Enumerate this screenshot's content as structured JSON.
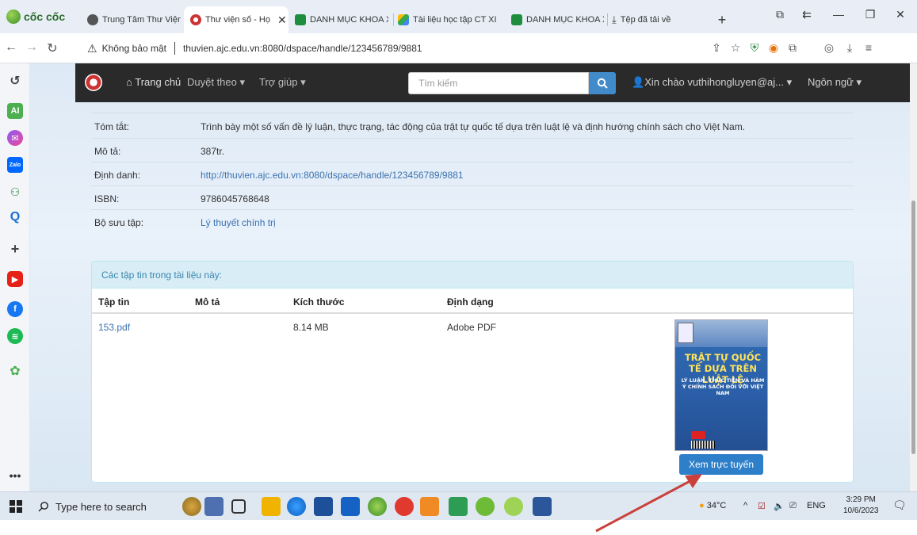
{
  "browser": {
    "brand": "cốc cốc",
    "tabs": [
      {
        "label": "Trung Tâm Thư Viện -",
        "active": false
      },
      {
        "label": "Thư viện số - Họ",
        "active": true
      },
      {
        "label": "DANH MỤC KHOA XI",
        "active": false
      },
      {
        "label": "Tài liệu học tập CT XI",
        "active": false
      },
      {
        "label": "DANH MỤC KHOA XI",
        "active": false
      },
      {
        "label": "Tệp đã tải về",
        "active": false
      }
    ],
    "security_label": "Không bảo mật",
    "url": "thuvien.ajc.edu.vn:8080/dspace/handle/123456789/9881"
  },
  "site_nav": {
    "home": "Trang chủ",
    "browse": "Duyệt theo",
    "help": "Trợ giúp",
    "search_placeholder": "Tìm kiếm",
    "greeting": "Xin chào vuthihongluyen@aj...",
    "language": "Ngôn ngữ"
  },
  "metadata": [
    {
      "label": "Tóm tắt:",
      "value": "Trình bày một số vấn đề lý luận, thực trạng, tác động của trật tự quốc tế dựa trên luật lệ và định hướng chính sách cho Việt Nam.",
      "link": false
    },
    {
      "label": "Mô tả:",
      "value": "387tr.",
      "link": false
    },
    {
      "label": "Định danh:",
      "value": "http://thuvien.ajc.edu.vn:8080/dspace/handle/123456789/9881",
      "link": true
    },
    {
      "label": "ISBN:",
      "value": "9786045768648",
      "link": false
    },
    {
      "label": "Bộ sưu tập:",
      "value": "Lý thuyết chính trị",
      "link": true
    }
  ],
  "files": {
    "panel_title": "Các tập tin trong tài liệu này:",
    "columns": [
      "Tập tin",
      "Mô tả",
      "Kích thước",
      "Định dạng"
    ],
    "rows": [
      {
        "file": "153.pdf",
        "description": "",
        "size": "8.14 MB",
        "format": "Adobe PDF"
      }
    ],
    "cover_title": "TRẬT TỰ QUỐC TẾ DỰA TRÊN LUẬT LỆ",
    "cover_subtitle": "LÝ LUẬN, THỰC TIỄN VÀ HÀM Ý CHÍNH SÁCH ĐỐI VỚI VIỆT NAM",
    "view_button": "Xem trực tuyến"
  },
  "taskbar": {
    "search_placeholder": "Type here to search",
    "weather": "34°C",
    "language": "ENG",
    "time": "3:29 PM",
    "date": "10/6/2023"
  },
  "colors": {
    "link": "#3a72b0",
    "view_button": "#2d7fc9",
    "annotation_arrow": "#c9413a"
  }
}
